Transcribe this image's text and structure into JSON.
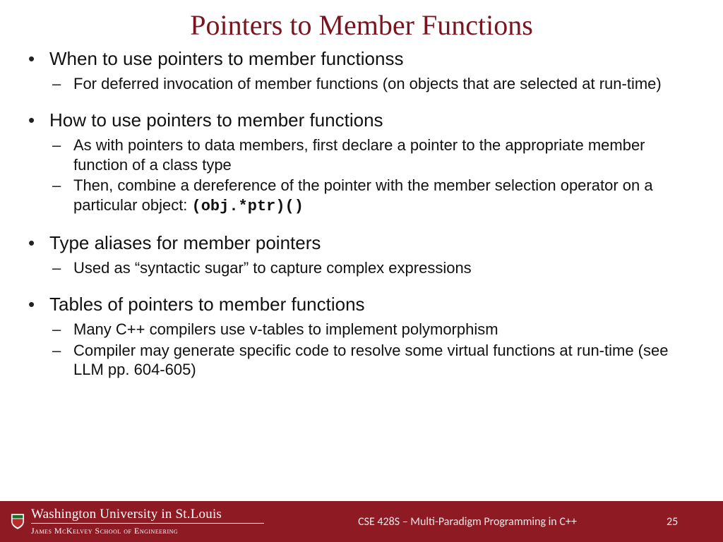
{
  "title": "Pointers to Member Functions",
  "items": [
    {
      "heading": "When to use pointers to member functionss",
      "subs": [
        "For deferred invocation of member functions (on objects that are selected at run-time)"
      ]
    },
    {
      "heading": "How to use pointers to member functions",
      "subs": [
        "As with pointers to data members, first declare a pointer to the appropriate member function of a class type",
        "Then, combine a dereference of the pointer with the member selection operator on a particular object: "
      ],
      "code_suffix_1": "(obj.*ptr)()"
    },
    {
      "heading": "Type aliases for member pointers",
      "subs": [
        "Used as “syntactic sugar” to capture complex expressions"
      ]
    },
    {
      "heading": "Tables of pointers to member functions",
      "subs": [
        "Many C++ compilers use v-tables to implement polymorphism",
        "Compiler may generate specific code to resolve some virtual functions at run-time (see LLM pp. 604-605)"
      ]
    }
  ],
  "footer": {
    "university": "Washington University in St.Louis",
    "school": "James McKelvey School of Engineering",
    "course": "CSE 428S – Multi-Paradigm Programming in C++",
    "page": "25"
  }
}
